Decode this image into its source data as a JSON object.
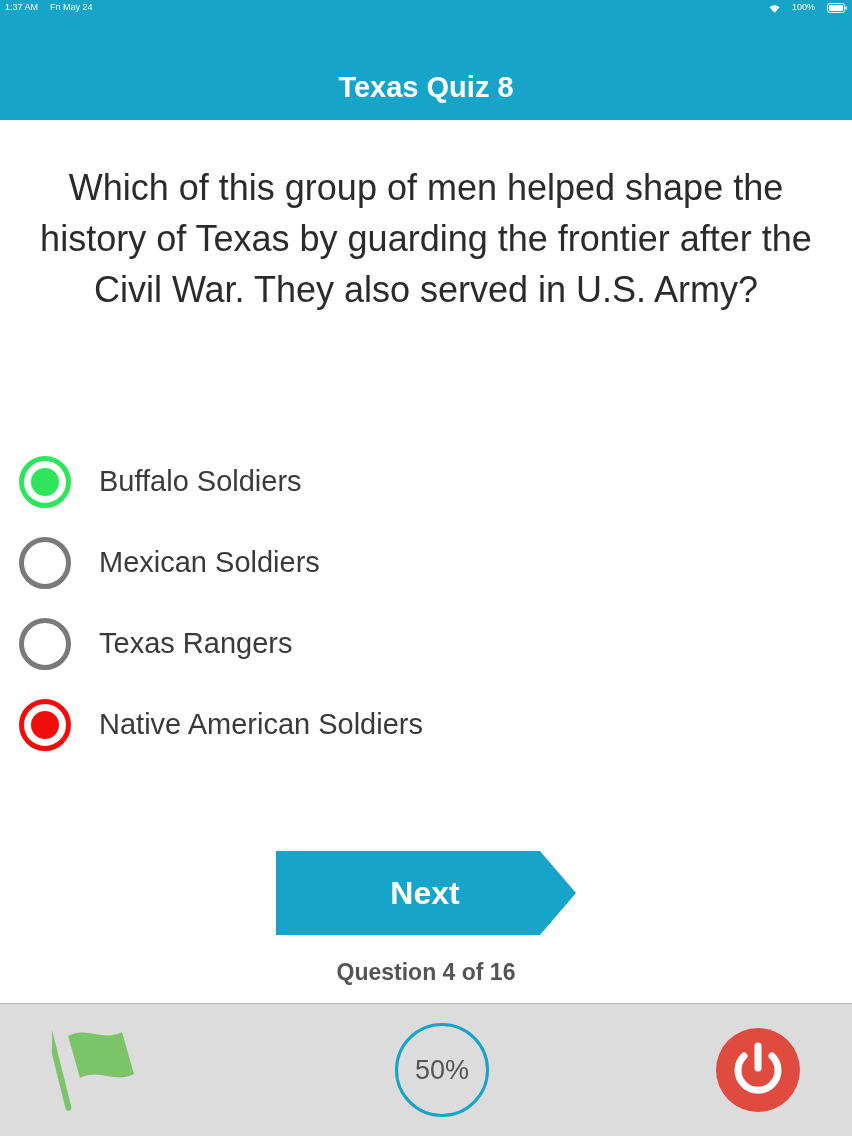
{
  "status_bar": {
    "time": "1:37 AM",
    "date": "Fri May 24",
    "battery": "100%"
  },
  "header": {
    "title": "Texas Quiz 8"
  },
  "question": "Which of this group of men helped shape the history of Texas by guarding the frontier after the Civil War. They also served in U.S. Army?",
  "options": [
    {
      "label": "Buffalo Soldiers",
      "kind": "correct"
    },
    {
      "label": "Mexican Soldiers",
      "kind": "none"
    },
    {
      "label": "Texas Rangers",
      "kind": "none"
    },
    {
      "label": "Native American Soldiers",
      "kind": "wrong"
    }
  ],
  "next_button": "Next",
  "counter": "Question 4 of 16",
  "toolbar": {
    "score": "50%"
  }
}
